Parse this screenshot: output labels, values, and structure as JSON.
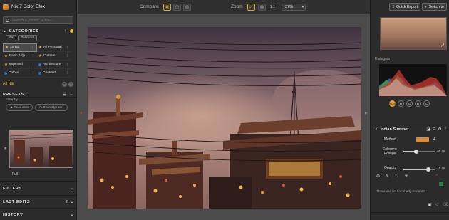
{
  "app": {
    "title": "Nik 7 Color Efex"
  },
  "search": {
    "placeholder": "Search a preset, a filter..."
  },
  "categories": {
    "header": "CATEGORIES",
    "tabs": [
      "Nik",
      "Personal"
    ],
    "items": [
      {
        "label": "All Nik",
        "icon": "star-icon",
        "selected": true
      },
      {
        "label": "All Personal",
        "icon": "star-icon"
      },
      {
        "label": "Basic Adju...",
        "icon": "star-icon"
      },
      {
        "label": "Custom",
        "icon": "star-icon"
      },
      {
        "label": "Imported",
        "icon": "star-icon"
      },
      {
        "label": "Architecture",
        "icon": "dot-icon"
      },
      {
        "label": "Colour",
        "icon": "dot-icon"
      },
      {
        "label": "Contrast",
        "icon": "dot-icon"
      }
    ]
  },
  "selected_category": "All Nik",
  "presets": {
    "header": "PRESETS",
    "filter_by": "Filter by",
    "pills": [
      "Favourites",
      "Recently used"
    ],
    "current_label": "Full"
  },
  "sections": {
    "filters": "FILTERS",
    "last_edits": "LAST EDITS",
    "last_edits_count": "2",
    "history": "HISTORY"
  },
  "toolbar": {
    "compare_label": "Compare",
    "zoom_label": "Zoom",
    "zoom_one": "1:1",
    "zoom_value": "37%"
  },
  "right": {
    "quick_export": "Quick Export",
    "switch_to": "Switch to",
    "histogram_label": "Histogram",
    "channels": [
      "RGB",
      "R",
      "G",
      "B",
      "L"
    ],
    "filter_name": "Indian Summer",
    "method_label": "Method",
    "method_value": "4",
    "enhance_label": "Enhance",
    "foliage_label": "Foliage",
    "enhance_value": "38 %",
    "opacity_label": "Opacity",
    "opacity_value": "78 %",
    "enhance_level": 38,
    "opacity_level": 78,
    "no_local": "There are no Local Adjustments"
  },
  "colors": {
    "accent": "#e9b72f",
    "panel": "#2b2b2b",
    "canvas": "#4b4b4b"
  }
}
